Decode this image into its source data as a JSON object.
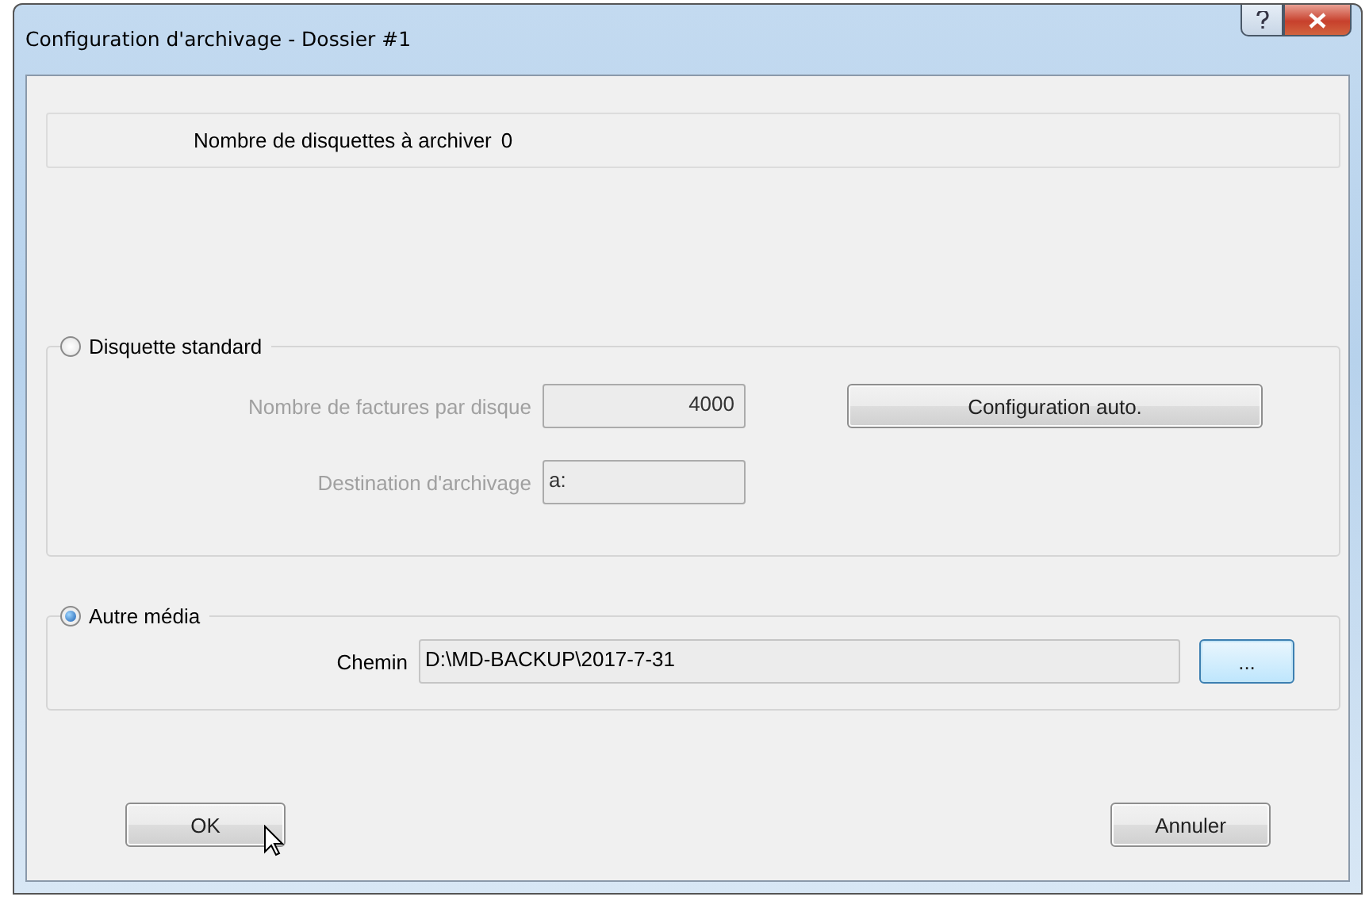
{
  "window": {
    "title": "Configuration d'archivage - Dossier #1"
  },
  "info": {
    "label": "Nombre de disquettes à archiver",
    "value": "0"
  },
  "groups": [
    {
      "label": "Disquette standard",
      "selected": false,
      "fields": [
        {
          "label": "Nombre de factures par disque",
          "value": "4000",
          "kind": "number",
          "disabled": true
        },
        {
          "label": "Destination d'archivage",
          "value": "a:",
          "kind": "text",
          "disabled": true
        }
      ],
      "side_button": "Configuration auto."
    },
    {
      "label": "Autre média",
      "selected": true,
      "fields": [
        {
          "label": "Chemin",
          "value": "D:\\MD-BACKUP\\2017-7-31",
          "kind": "text",
          "disabled": false
        }
      ],
      "browse_button": "..."
    }
  ],
  "buttons": [
    {
      "label": "OK",
      "hovered": true
    },
    {
      "label": "Annuler",
      "hovered": false
    }
  ]
}
